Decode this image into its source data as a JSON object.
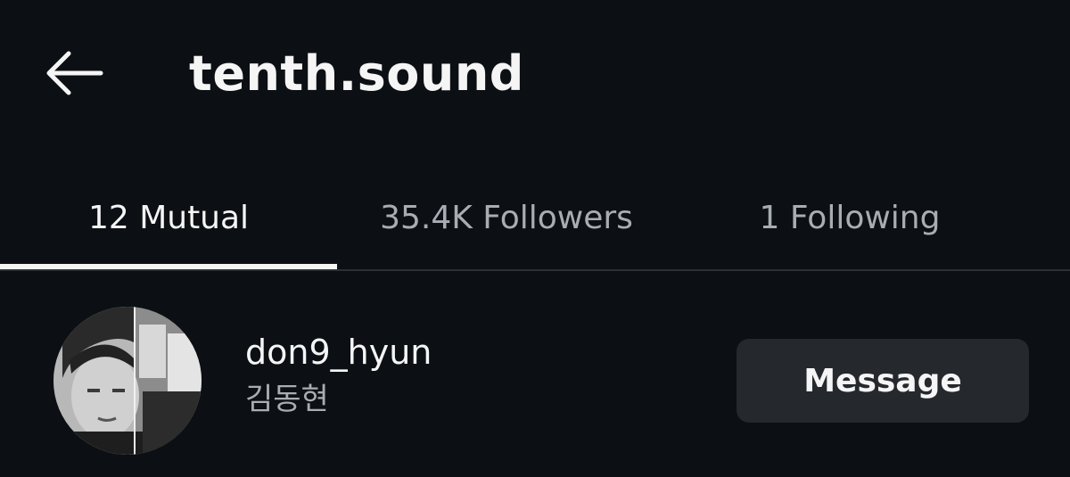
{
  "header": {
    "title": "tenth.sound",
    "back_icon": "arrow-left-icon"
  },
  "tabs": [
    {
      "label": "12 Mutual",
      "active": true
    },
    {
      "label": "35.4K Followers",
      "active": false
    },
    {
      "label": "1 Following",
      "active": false
    }
  ],
  "users": [
    {
      "username": "don9_hyun",
      "full_name": "김동현",
      "button_label": "Message"
    }
  ],
  "colors": {
    "background": "#0c1014",
    "text_primary": "#f5f5f5",
    "text_secondary": "#a8adb4",
    "button_bg": "#25292e",
    "divider": "#2b3036"
  }
}
